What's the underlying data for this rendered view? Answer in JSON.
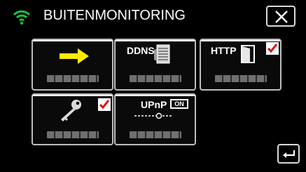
{
  "header": {
    "title": "BUITENMONITORING",
    "wifi_icon": "wifi-icon",
    "close_icon": "close-icon"
  },
  "tiles": [
    {
      "name": "forward-arrow-tile",
      "icon": "yellow-arrow-icon",
      "label": ""
    },
    {
      "name": "ddns-tile",
      "icon": "server-icon",
      "label": "DDNS"
    },
    {
      "name": "http-tile",
      "icon": "door-icon",
      "label": "HTTP",
      "checked": true
    },
    {
      "name": "key-tile",
      "icon": "key-icon",
      "label": "",
      "checked": true
    },
    {
      "name": "upnp-tile",
      "icon": "network-icon",
      "label": "UPnP",
      "badge": "ON"
    }
  ],
  "footer": {
    "back_icon": "return-icon"
  },
  "colors": {
    "arrow": "#ffeb00",
    "check": "#e01010",
    "wifi": "#19c43a"
  }
}
